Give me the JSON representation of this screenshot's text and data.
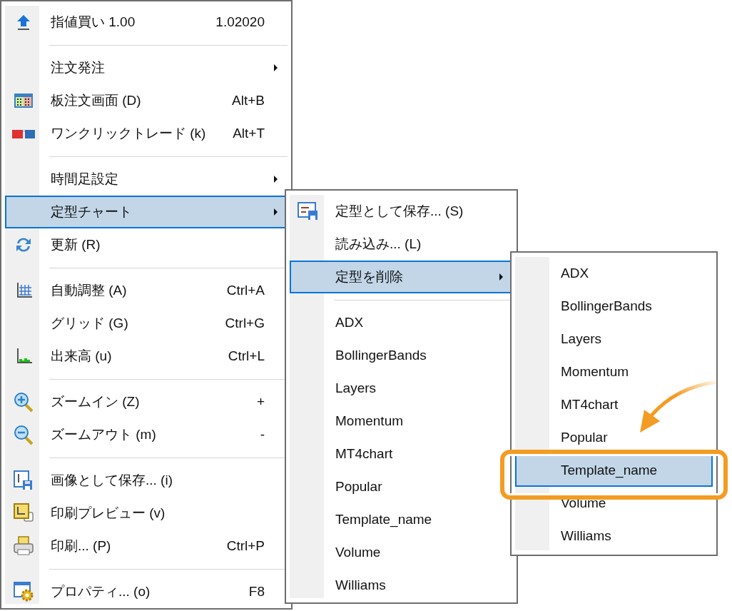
{
  "main_menu": {
    "items": [
      {
        "kind": "item",
        "label": "指値買い 1.00",
        "shortcut": "1.02020",
        "submenu": false,
        "selected": false
      },
      {
        "kind": "separator"
      },
      {
        "kind": "item",
        "label": "注文発注",
        "submenu": true,
        "selected": false
      },
      {
        "kind": "item",
        "label": "板注文画面 (D)",
        "shortcut": "Alt+B",
        "submenu": false,
        "selected": false
      },
      {
        "kind": "item",
        "label": "ワンクリックトレード (k)",
        "shortcut": "Alt+T",
        "submenu": false,
        "selected": false
      },
      {
        "kind": "separator"
      },
      {
        "kind": "item",
        "label": "時間足設定",
        "submenu": true,
        "selected": false
      },
      {
        "kind": "item",
        "label": "定型チャート",
        "submenu": true,
        "selected": true
      },
      {
        "kind": "item",
        "label": "更新 (R)",
        "submenu": false,
        "selected": false
      },
      {
        "kind": "separator"
      },
      {
        "kind": "item",
        "label": "自動調整 (A)",
        "shortcut": "Ctrl+A",
        "submenu": false,
        "selected": false
      },
      {
        "kind": "item",
        "label": "グリッド (G)",
        "shortcut": "Ctrl+G",
        "submenu": false,
        "selected": false
      },
      {
        "kind": "item",
        "label": "出来高 (u)",
        "shortcut": "Ctrl+L",
        "submenu": false,
        "selected": false
      },
      {
        "kind": "separator"
      },
      {
        "kind": "item",
        "label": "ズームイン (Z)",
        "shortcut": "+",
        "submenu": false,
        "selected": false
      },
      {
        "kind": "item",
        "label": "ズームアウト (m)",
        "shortcut": "-",
        "submenu": false,
        "selected": false
      },
      {
        "kind": "separator"
      },
      {
        "kind": "item",
        "label": "画像として保存... (i)",
        "submenu": false,
        "selected": false
      },
      {
        "kind": "item",
        "label": "印刷プレビュー (v)",
        "submenu": false,
        "selected": false
      },
      {
        "kind": "item",
        "label": "印刷... (P)",
        "shortcut": "Ctrl+P",
        "submenu": false,
        "selected": false
      },
      {
        "kind": "separator"
      },
      {
        "kind": "item",
        "label": "プロパティ... (o)",
        "shortcut": "F8",
        "submenu": false,
        "selected": false
      }
    ]
  },
  "template_menu": {
    "items": [
      {
        "kind": "item",
        "label": "定型として保存... (S)",
        "submenu": false,
        "selected": false
      },
      {
        "kind": "item",
        "label": "読み込み... (L)",
        "submenu": false,
        "selected": false
      },
      {
        "kind": "item",
        "label": "定型を削除",
        "submenu": true,
        "selected": true
      },
      {
        "kind": "separator"
      },
      {
        "kind": "item",
        "label": "ADX",
        "submenu": false,
        "selected": false
      },
      {
        "kind": "item",
        "label": "BollingerBands",
        "submenu": false,
        "selected": false
      },
      {
        "kind": "item",
        "label": "Layers",
        "submenu": false,
        "selected": false
      },
      {
        "kind": "item",
        "label": "Momentum",
        "submenu": false,
        "selected": false
      },
      {
        "kind": "item",
        "label": "MT4chart",
        "submenu": false,
        "selected": false
      },
      {
        "kind": "item",
        "label": "Popular",
        "submenu": false,
        "selected": false
      },
      {
        "kind": "item",
        "label": "Template_name",
        "submenu": false,
        "selected": false
      },
      {
        "kind": "item",
        "label": "Volume",
        "submenu": false,
        "selected": false
      },
      {
        "kind": "item",
        "label": "Williams",
        "submenu": false,
        "selected": false
      }
    ]
  },
  "delete_menu": {
    "items": [
      {
        "kind": "item",
        "label": "ADX",
        "submenu": false,
        "selected": false
      },
      {
        "kind": "item",
        "label": "BollingerBands",
        "submenu": false,
        "selected": false
      },
      {
        "kind": "item",
        "label": "Layers",
        "submenu": false,
        "selected": false
      },
      {
        "kind": "item",
        "label": "Momentum",
        "submenu": false,
        "selected": false
      },
      {
        "kind": "item",
        "label": "MT4chart",
        "submenu": false,
        "selected": false
      },
      {
        "kind": "item",
        "label": "Popular",
        "submenu": false,
        "selected": false
      },
      {
        "kind": "item",
        "label": "Template_name",
        "submenu": false,
        "selected": true,
        "highlighted": true
      },
      {
        "kind": "item",
        "label": "Volume",
        "submenu": false,
        "selected": false
      },
      {
        "kind": "item",
        "label": "Williams",
        "submenu": false,
        "selected": false
      }
    ]
  }
}
